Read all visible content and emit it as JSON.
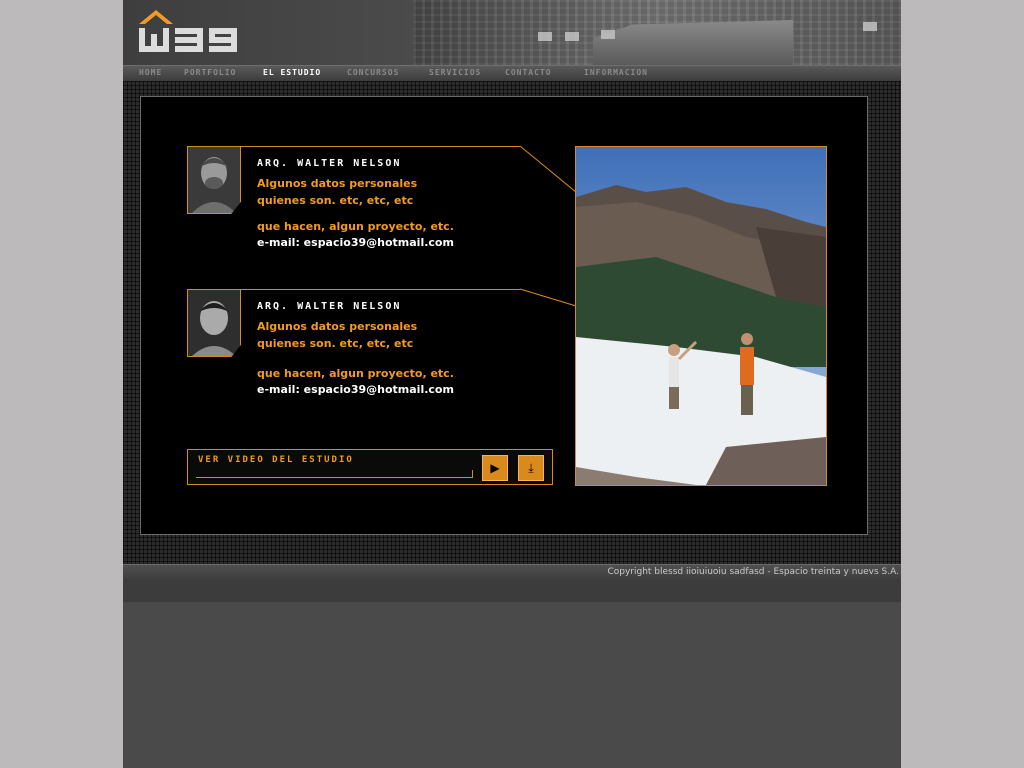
{
  "brand": {
    "logo_text": "w39",
    "accent": "#f39a22"
  },
  "nav": {
    "items": [
      {
        "label": "HOME"
      },
      {
        "label": "PORTFOLIO"
      },
      {
        "label": "EL ESTUDIO"
      },
      {
        "label": "CONCURSOS"
      },
      {
        "label": "SERVICIOS"
      },
      {
        "label": "CONTACTO"
      },
      {
        "label": "INFORMACION"
      }
    ],
    "active": "EL ESTUDIO"
  },
  "people": [
    {
      "name": "ARQ. WALTER NELSON",
      "line1": "Algunos datos personales",
      "line2": "quienes son. etc, etc, etc",
      "line3": "que hacen, algun proyecto, etc.",
      "email": "e-mail: espacio39@hotmail.com"
    },
    {
      "name": "ARQ. WALTER NELSON",
      "line1": "Algunos datos personales",
      "line2": "quienes son. etc, etc, etc",
      "line3": "que hacen, algun proyecto, etc.",
      "email": "e-mail: espacio39@hotmail.com"
    }
  ],
  "video": {
    "label": "VER VIDEO DEL ESTUDIO",
    "play_icon": "play-icon",
    "download_icon": "download-icon"
  },
  "footer": {
    "copyright": "Copyright blessd iioiuiuoiu sadfasd - Espacio treinta y nuevs S.A."
  }
}
